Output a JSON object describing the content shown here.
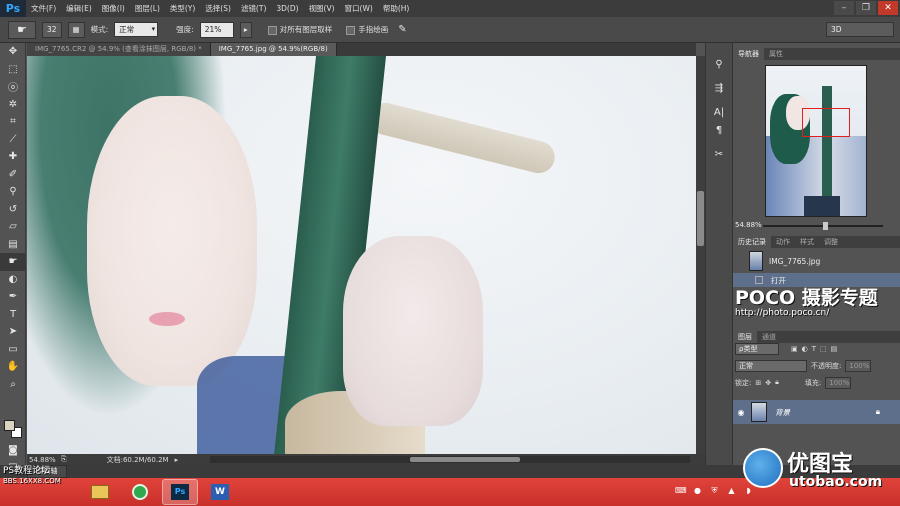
{
  "app": {
    "logo": "Ps"
  },
  "menu": [
    "文件(F)",
    "编辑(E)",
    "图像(I)",
    "图层(L)",
    "类型(Y)",
    "选择(S)",
    "滤镜(T)",
    "3D(D)",
    "视图(V)",
    "窗口(W)",
    "帮助(H)"
  ],
  "window_controls": {
    "minimize": "–",
    "restore": "❐",
    "close": "✕"
  },
  "options": {
    "brush_size": "32",
    "mode_label": "模式:",
    "mode_value": "正常",
    "strength_label": "强度:",
    "strength_value": "21%",
    "sample_all_label": "对所有图层取样",
    "finger_paint_label": "手指绘画",
    "workspace": "3D"
  },
  "tabs": [
    {
      "label": "IMG_7765.CR2 @ 54.9% (查看涂抹图层, RGB/8) *",
      "active": false
    },
    {
      "label": "IMG_7765.jpg @ 54.9%(RGB/8)",
      "active": true
    }
  ],
  "status": {
    "zoom": "54.88%",
    "doc_size": "文档:60.2M/60.2M"
  },
  "timeline_tab": "时间轴",
  "watermark_left": {
    "line1": "PS教程论坛",
    "line2": "BBS.16XX8.COM"
  },
  "navigator": {
    "tabs": [
      "导航器",
      "属性"
    ],
    "zoom": "54.88%"
  },
  "history": {
    "tabs": [
      "历史记录",
      "动作",
      "样式",
      "调整"
    ],
    "items": [
      "IMG_7765.jpg",
      "打开"
    ]
  },
  "poco": {
    "big": "POCO 摄影专题",
    "url": "http://photo.poco.cn/"
  },
  "layers": {
    "tabs": [
      "图层",
      "通道"
    ],
    "filter": "ρ类型",
    "blend_mode": "正常",
    "opacity_label": "不透明度:",
    "opacity_value": "100%",
    "lock_label": "锁定:",
    "fill_label": "填充:",
    "fill_value": "100%",
    "items": [
      {
        "name": "背景"
      }
    ]
  },
  "utobao": {
    "cn": "优图宝",
    "en": "utobao.com"
  }
}
